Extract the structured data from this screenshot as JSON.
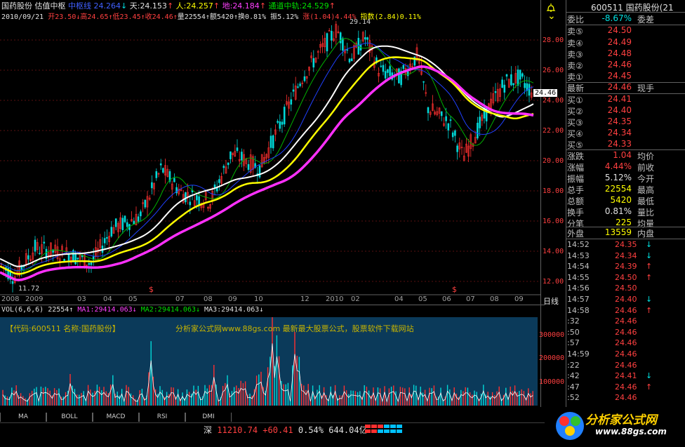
{
  "header": {
    "stock_name": "国药股份",
    "indicator": "估值中枢",
    "mid_label": "中枢线",
    "mid_val": "24.264",
    "mid_arrow": "↓",
    "sky_label": "天:",
    "sky_val": "24.153",
    "sky_arrow": "↑",
    "man_label": "人:",
    "man_val": "24.257",
    "man_arrow": "↑",
    "earth_label": "地:",
    "earth_val": "24.184",
    "earth_arrow": "↑",
    "channel_label": "通道中轨:",
    "channel_val": "24.529",
    "channel_arrow": "↑"
  },
  "quote_line": {
    "date": "2010/09/21",
    "open": "开23.50↓",
    "high": "高24.65↑",
    "low": "低23.45↑",
    "close": "收24.46↑",
    "volume": "量22554↑",
    "amount": "额5420↑",
    "turnover": "换0.81%",
    "amplitude": "振5.12%",
    "change": "涨(1.04)4.44%",
    "index": "指数(2.84)0.11%"
  },
  "chart": {
    "y_ticks": [
      "28.00",
      "26.00",
      "24.00",
      "22.00",
      "20.00",
      "18.00",
      "16.00",
      "14.00",
      "12.00"
    ],
    "high_mark": "29.14",
    "low_mark": "11.72",
    "current_price": "24.46",
    "x_ticks": [
      "2008",
      "2009",
      "03",
      "04",
      "05",
      "07",
      "08",
      "09",
      "10",
      "12",
      "2010",
      "02",
      "04",
      "05",
      "06",
      "07",
      "08",
      "09"
    ],
    "period": "日线",
    "signal_marks": [
      "$",
      "$"
    ]
  },
  "volume": {
    "header": "VOL(6,6,6) 22554↑",
    "ma1": "MA1:29414.063↓",
    "ma2": "MA2:29414.063↓",
    "ma3": "MA3:29414.063↓",
    "ticks": [
      "300000",
      "200000",
      "100000"
    ],
    "ad1": "【代码:600511 名称:国药股份】",
    "ad2": "分析家公式网www.88gs.com 最新最大股票公式，股票软件下载网站"
  },
  "tabs": [
    "MA",
    "BOLL",
    "MACD",
    "RSI",
    "DMI"
  ],
  "status": {
    "market": "深",
    "index": "11210.74",
    "change": "+60.41",
    "pct": "0.54%",
    "amount": "644.04亿"
  },
  "panel": {
    "code": "600511",
    "name": "国药股份(21",
    "webi_label": "委比",
    "webi_val": "-8.67%",
    "webi_diff_label": "委差",
    "asks": [
      {
        "label": "卖⑤",
        "price": "24.50"
      },
      {
        "label": "卖④",
        "price": "24.49"
      },
      {
        "label": "卖③",
        "price": "24.48"
      },
      {
        "label": "卖②",
        "price": "24.46"
      },
      {
        "label": "卖①",
        "price": "24.45"
      }
    ],
    "last_label": "最新",
    "last_val": "24.46",
    "hand_label": "现手",
    "bids": [
      {
        "label": "买①",
        "price": "24.41"
      },
      {
        "label": "买②",
        "price": "24.40"
      },
      {
        "label": "买③",
        "price": "24.35"
      },
      {
        "label": "买④",
        "price": "24.34"
      },
      {
        "label": "买⑤",
        "price": "24.33"
      }
    ],
    "stats": [
      {
        "l1": "涨跌",
        "v1": "1.04",
        "l2": "均价"
      },
      {
        "l1": "涨幅",
        "v1": "4.44%",
        "l2": "前收"
      },
      {
        "l1": "振幅",
        "v1": "5.12%",
        "l2": "今开"
      },
      {
        "l1": "总手",
        "v1": "22554",
        "l2": "最高"
      },
      {
        "l1": "总额",
        "v1": "5420",
        "l2": "最低"
      },
      {
        "l1": "换手",
        "v1": "0.81%",
        "l2": "量比"
      },
      {
        "l1": "分笔",
        "v1": "225",
        "l2": "均量"
      }
    ],
    "outer_label": "外盘",
    "outer_val": "13559",
    "inner_label": "内盘",
    "ticks": [
      {
        "t": "14:52",
        "p": "24.35",
        "a": "↓"
      },
      {
        "t": "14:53",
        "p": "24.34",
        "a": "↓"
      },
      {
        "t": "14:54",
        "p": "24.39",
        "a": "↑"
      },
      {
        "t": "14:55",
        "p": "24.50",
        "a": "↑"
      },
      {
        "t": "14:56",
        "p": "24.50",
        "a": ""
      },
      {
        "t": "14:57",
        "p": "24.40",
        "a": "↓"
      },
      {
        "t": "14:58",
        "p": "24.46",
        "a": "↑"
      },
      {
        "t": ":32",
        "p": "24.46",
        "a": ""
      },
      {
        "t": ":50",
        "p": "24.46",
        "a": ""
      },
      {
        "t": ":57",
        "p": "24.46",
        "a": ""
      },
      {
        "t": "14:59",
        "p": "24.46",
        "a": ""
      },
      {
        "t": ":22",
        "p": "24.46",
        "a": ""
      },
      {
        "t": ":42",
        "p": "24.41",
        "a": "↓"
      },
      {
        "t": ":47",
        "p": "24.46",
        "a": "↑"
      },
      {
        "t": ":52",
        "p": "24.46",
        "a": ""
      }
    ]
  },
  "logo": {
    "name": "分析家公式网",
    "url": "www.88gs.com"
  },
  "colors": {
    "up": "#ff4040",
    "down": "#00e0e0",
    "ma_white": "#ffffff",
    "ma_yellow": "#ffff00",
    "ma_magenta": "#ff40ff",
    "ma_green": "#00c000",
    "ma_blue": "#2040ff"
  }
}
